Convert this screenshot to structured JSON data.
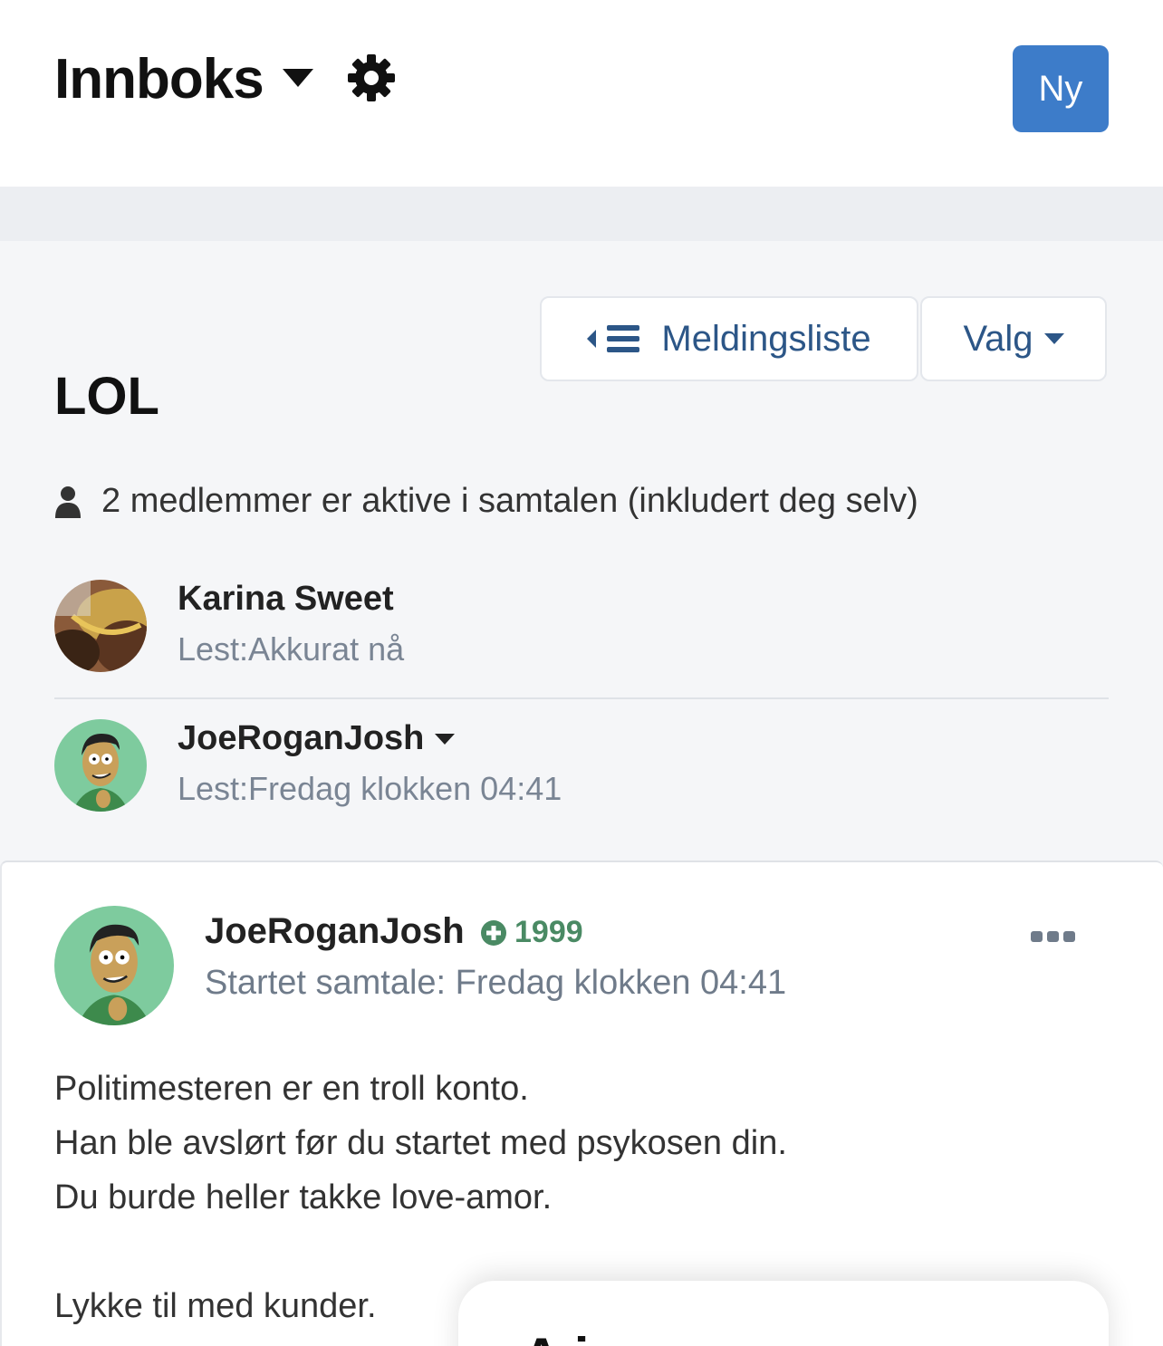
{
  "header": {
    "title": "Innboks",
    "new_button": "Ny"
  },
  "toolbar": {
    "message_list_label": "Meldingsliste",
    "options_label": "Valg"
  },
  "conversation": {
    "title": "LOL",
    "members_text": "2 medlemmer er aktive i samtalen (inkludert deg selv)",
    "participants": [
      {
        "name": "Karina Sweet",
        "read_status": "Lest:Akkurat nå"
      },
      {
        "name": "JoeRoganJosh",
        "read_status": "Lest:Fredag klokken 04:41"
      }
    ]
  },
  "post": {
    "author": "JoeRoganJosh",
    "reputation": "1999",
    "started": "Startet samtale: Fredag klokken 04:41",
    "body": [
      "Politimesteren er en troll konto.",
      "Han ble avslørt før du startet med psykosen din.",
      "Du burde heller takke love-amor.",
      "",
      "Lykke til med kunder."
    ]
  },
  "popup": {
    "peek_text": "A i"
  },
  "colors": {
    "primary": "#3d7cc9",
    "link": "#2c5687",
    "reputation": "#4a8a64",
    "muted": "#7a8594",
    "background": "#f5f6f8"
  },
  "icons": {
    "dropdown": "caret-down-icon",
    "settings": "gear-icon",
    "list": "list-collapse-icon",
    "user": "user-icon",
    "reputation": "plus-circle-icon",
    "more": "ellipsis-icon"
  }
}
